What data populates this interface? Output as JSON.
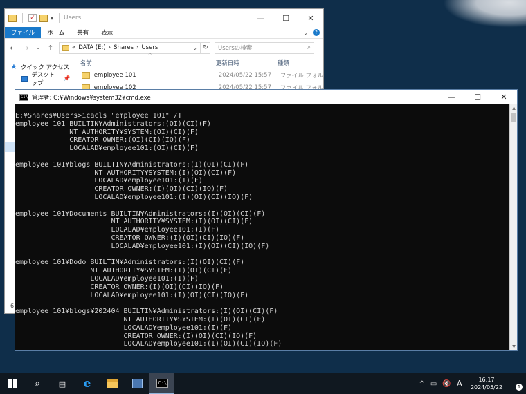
{
  "explorer": {
    "title": "Users",
    "ribbon_tabs": [
      "ファイル",
      "ホーム",
      "共有",
      "表示"
    ],
    "address": {
      "prefix": "«",
      "crumbs": [
        "DATA (E:)",
        "Shares",
        "Users"
      ],
      "separator": "›"
    },
    "search_placeholder": "Usersの検索",
    "nav_items": [
      {
        "label": "クイック アクセス",
        "icon": "star-icon"
      },
      {
        "label": "デスクトップ",
        "icon": "desktop-icon"
      }
    ],
    "columns": [
      "名前",
      "更新日時",
      "種類"
    ],
    "files": [
      {
        "name": "employee 101",
        "date": "2024/05/22 15:57",
        "type": "ファイル フォル"
      },
      {
        "name": "employee 102",
        "date": "2024/05/22 15:57",
        "type": "ファイル フォル"
      }
    ],
    "status_text": "6"
  },
  "cmd": {
    "title": "管理者: C:¥Windows¥system32¥cmd.exe",
    "icon_text": "C:\\",
    "lines": [
      "E:¥Shares¥Users>icacls \"employee 101\" /T",
      "employee 101 BUILTIN¥Administrators:(OI)(CI)(F)",
      "             NT AUTHORITY¥SYSTEM:(OI)(CI)(F)",
      "             CREATOR OWNER:(OI)(CI)(IO)(F)",
      "             LOCALAD¥employee101:(OI)(CI)(F)",
      "",
      "employee 101¥blogs BUILTIN¥Administrators:(I)(OI)(CI)(F)",
      "                   NT AUTHORITY¥SYSTEM:(I)(OI)(CI)(F)",
      "                   LOCALAD¥employee101:(I)(F)",
      "                   CREATOR OWNER:(I)(OI)(CI)(IO)(F)",
      "                   LOCALAD¥employee101:(I)(OI)(CI)(IO)(F)",
      "",
      "employee 101¥Documents BUILTIN¥Administrators:(I)(OI)(CI)(F)",
      "                       NT AUTHORITY¥SYSTEM:(I)(OI)(CI)(F)",
      "                       LOCALAD¥employee101:(I)(F)",
      "                       CREATOR OWNER:(I)(OI)(CI)(IO)(F)",
      "                       LOCALAD¥employee101:(I)(OI)(CI)(IO)(F)",
      "",
      "employee 101¥Dodo BUILTIN¥Administrators:(I)(OI)(CI)(F)",
      "                  NT AUTHORITY¥SYSTEM:(I)(OI)(CI)(F)",
      "                  LOCALAD¥employee101:(I)(F)",
      "                  CREATOR OWNER:(I)(OI)(CI)(IO)(F)",
      "                  LOCALAD¥employee101:(I)(OI)(CI)(IO)(F)",
      "",
      "employee 101¥blogs¥202404 BUILTIN¥Administrators:(I)(OI)(CI)(F)",
      "                          NT AUTHORITY¥SYSTEM:(I)(OI)(CI)(F)",
      "                          LOCALAD¥employee101:(I)(F)",
      "                          CREATOR OWNER:(I)(OI)(CI)(IO)(F)",
      "                          LOCALAD¥employee101:(I)(OI)(CI)(IO)(F)"
    ]
  },
  "taskbar": {
    "ime": "A",
    "time": "16:17",
    "date": "2024/05/22",
    "notification_count": "1",
    "cmd_icon_text": "C:\\"
  }
}
